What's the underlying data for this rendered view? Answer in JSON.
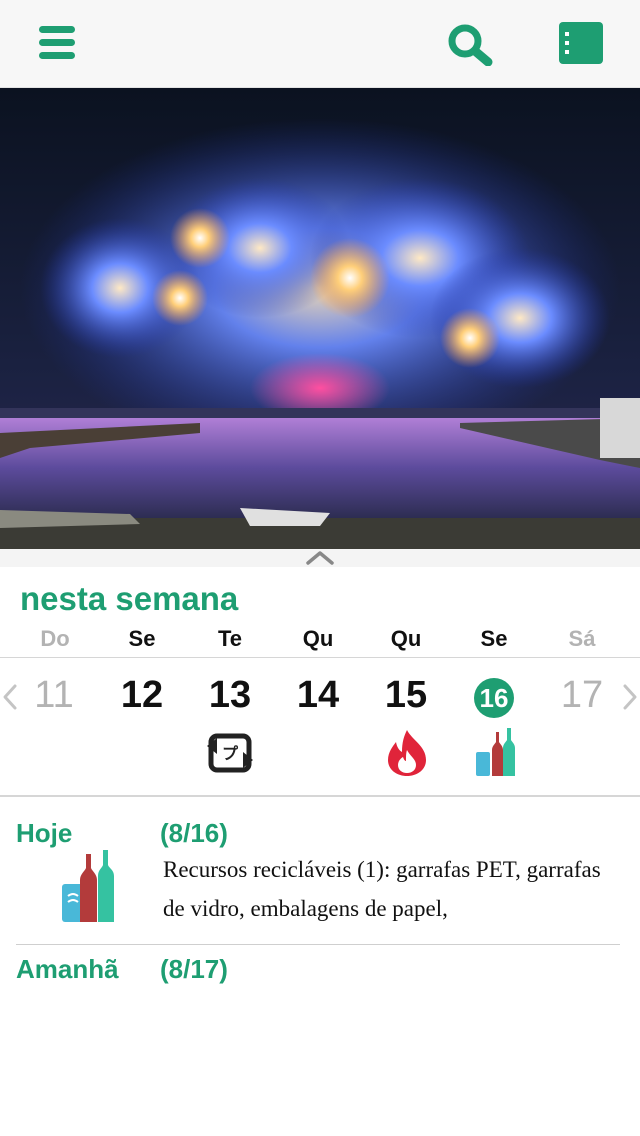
{
  "header": {
    "menu_icon": "hamburger-menu-icon",
    "search_icon": "search-icon",
    "list_icon": "list-view-icon",
    "accent_color": "#1e9e72"
  },
  "week": {
    "title": "nesta semana",
    "weekdays": [
      "Do",
      "Se",
      "Te",
      "Qu",
      "Qu",
      "Se",
      "Sá"
    ],
    "days": [
      "11",
      "12",
      "13",
      "14",
      "15",
      "16",
      "17"
    ],
    "today_index": 5,
    "day_icons": [
      "",
      "",
      "recycle-icon",
      "",
      "burnable-fire-icon",
      "bottles-cans-icon",
      ""
    ]
  },
  "today": {
    "label": "Hoje",
    "date": "(8/16)",
    "description": "Recursos recicláveis (1): garrafas PET, garrafas de vidro, embalagens de papel,"
  },
  "tomorrow": {
    "label": "Amanhã",
    "date": "(8/17)"
  }
}
